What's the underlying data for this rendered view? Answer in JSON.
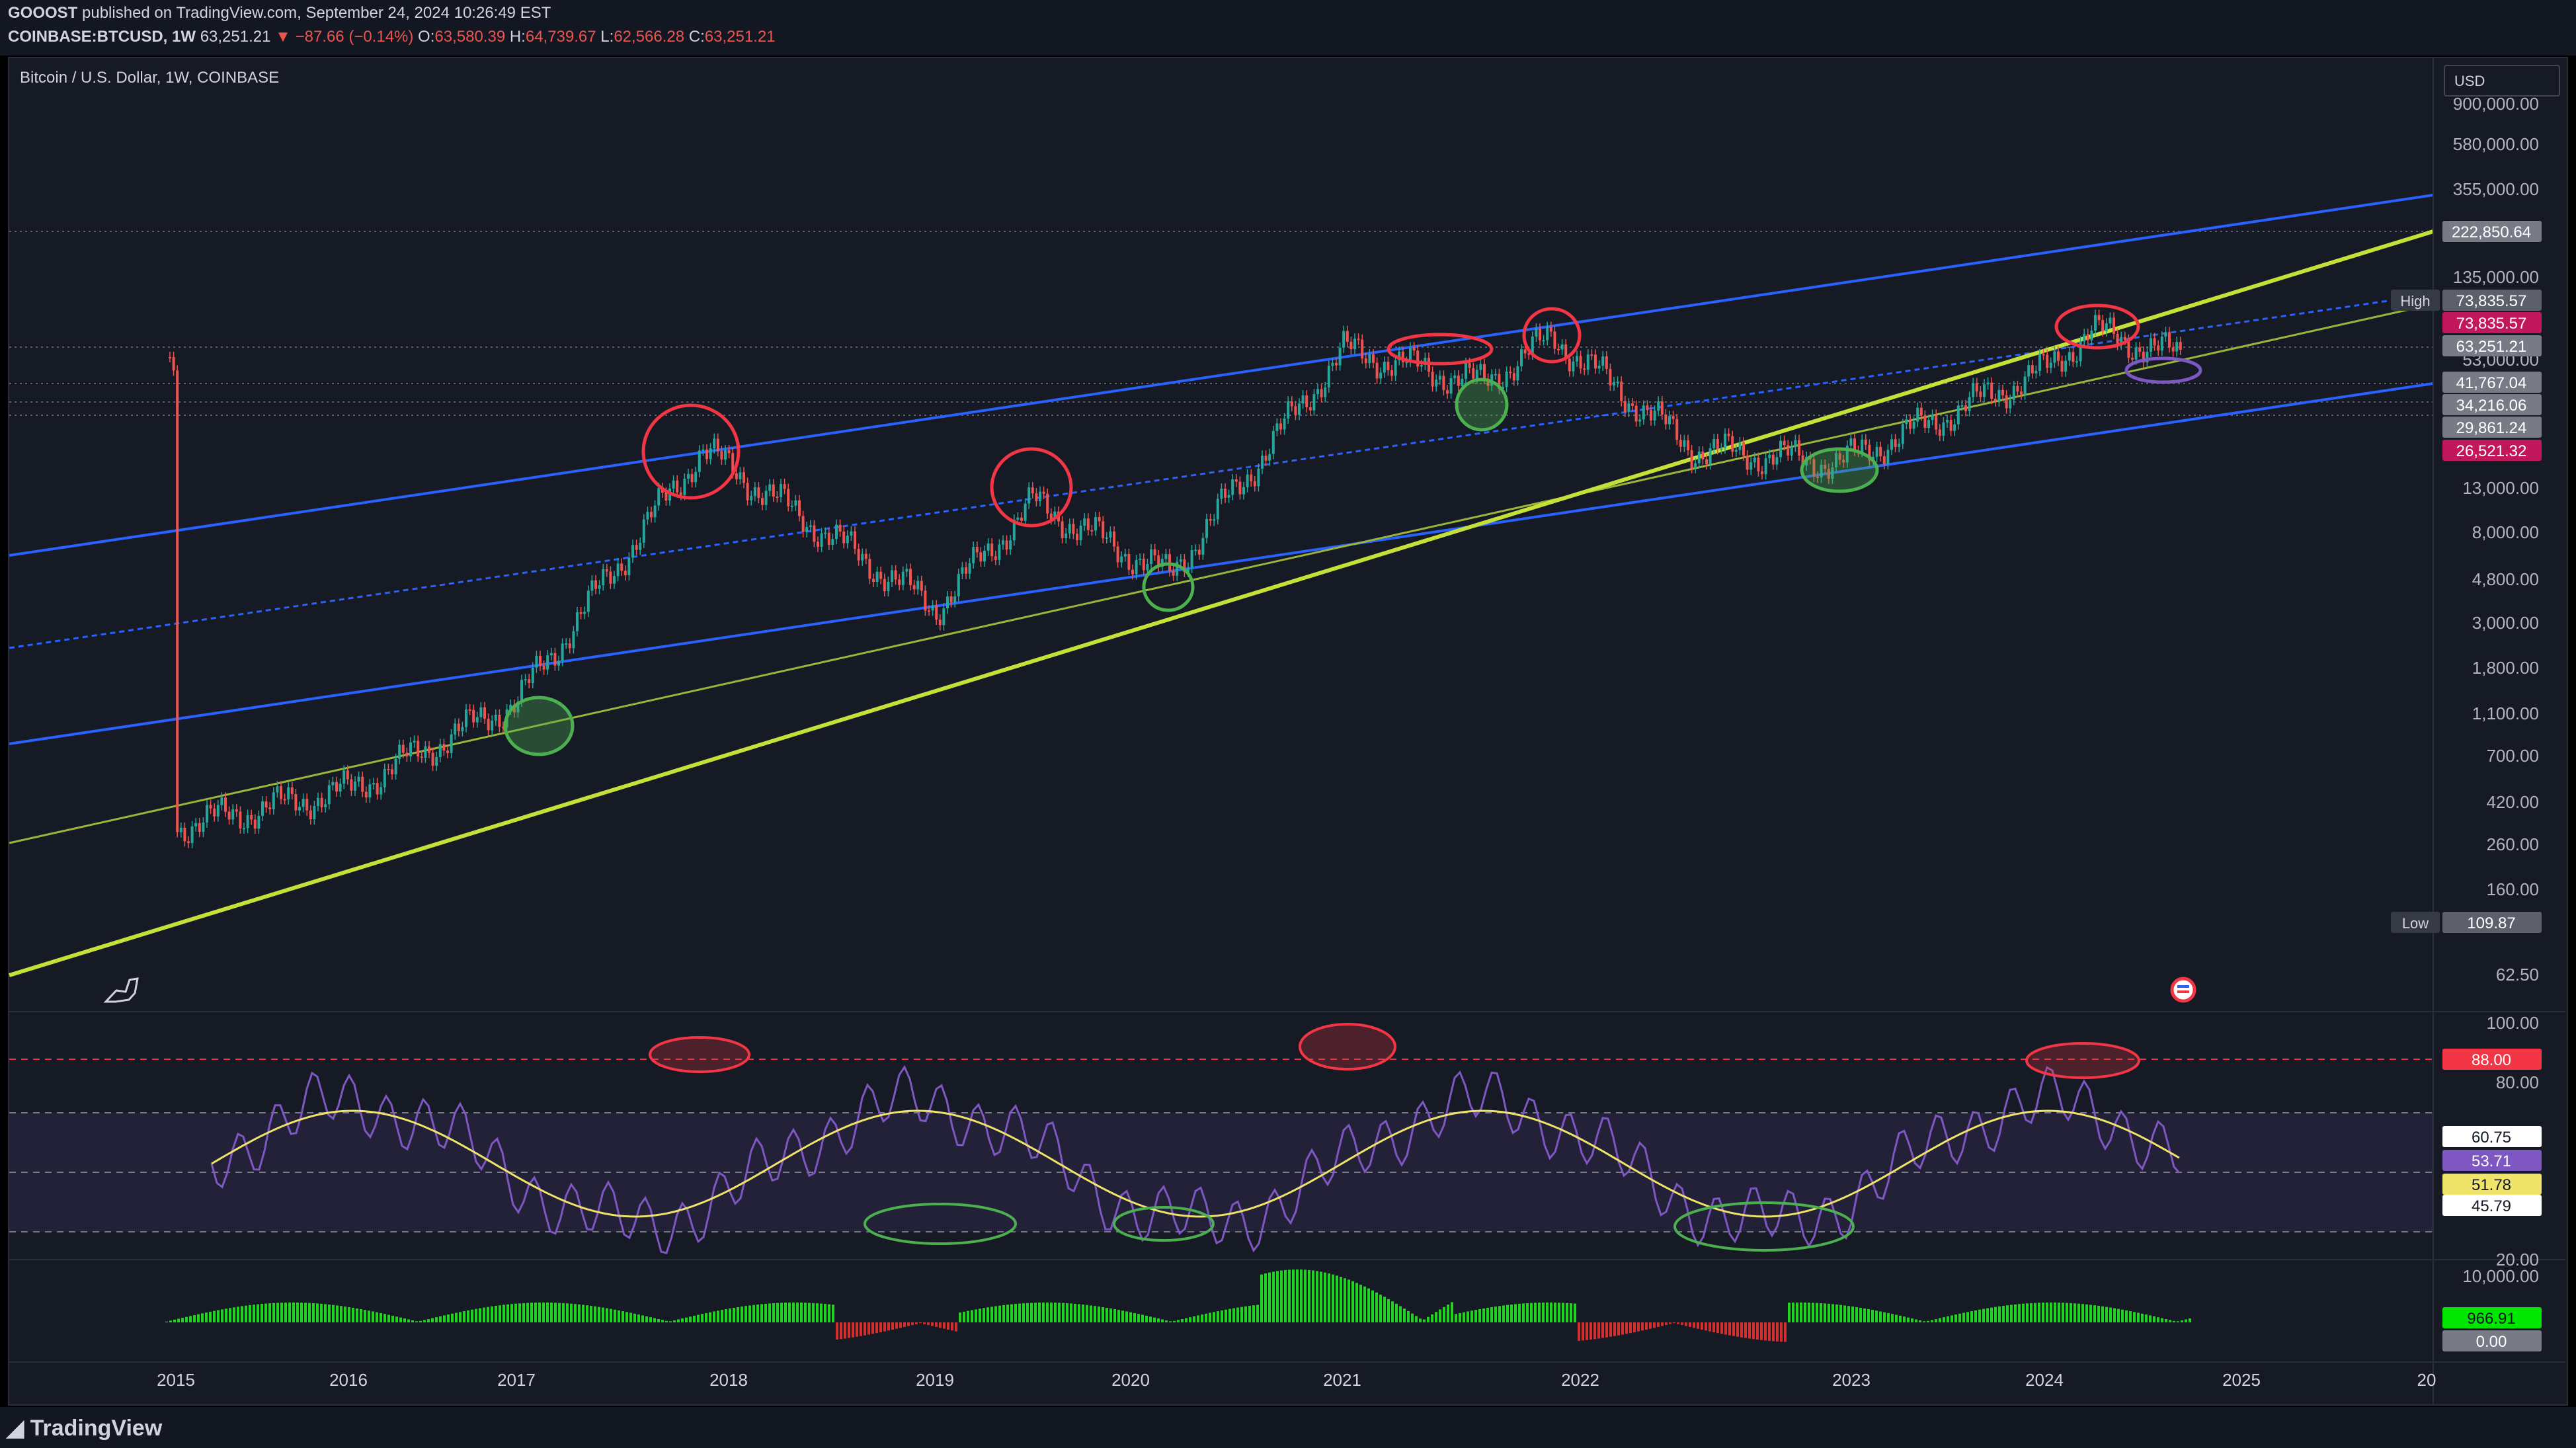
{
  "header": {
    "publisher": "GOOOST",
    "published_text": "published on TradingView.com, September 24, 2024 10:26:49 EST",
    "symbol": "COINBASE:BTCUSD, 1W",
    "last": "63,251.21",
    "change": "−87.66 (−0.14%)",
    "open_label": "O:",
    "open": "63,580.39",
    "high_label": "H:",
    "high": "64,739.67",
    "low_label": "L:",
    "low": "62,566.28",
    "close_label": "C:",
    "close": "63,251.21"
  },
  "chart_title": "Bitcoin / U.S. Dollar, 1W, COINBASE",
  "currency": "USD",
  "footer_logo": "TradingView",
  "colors": {
    "background": "#161a25",
    "channel_blue": "#2962ff",
    "trend_yellow": "#c6e03a",
    "trend_olive": "#9bb53a",
    "rsi_purple": "#7e57c2",
    "rsi_ma_yellow": "#f0e36a",
    "up_candle": "#26a69a",
    "down_candle": "#ef5350",
    "red_circle": "#f23645",
    "green_circle": "#4caf50"
  },
  "price_axis": {
    "ticks": [
      "900,000.00",
      "580,000.00",
      "355,000.00",
      "135,000.00",
      "53,000.00",
      "13,000.00",
      "8,000.00",
      "4,800.00",
      "3,000.00",
      "1,800.00",
      "1,100.00",
      "700.00",
      "420.00",
      "260.00",
      "160.00",
      "62.50"
    ],
    "badges": [
      {
        "label": "",
        "value": "222,850.64",
        "color": "#787b86"
      },
      {
        "label": "High",
        "value": "73,835.57",
        "color": "#5d606b"
      },
      {
        "label": "",
        "value": "73,835.57",
        "color": "#c2185b"
      },
      {
        "label": "",
        "value": "63,251.21",
        "color": "#787b86"
      },
      {
        "label": "",
        "value": "41,767.04",
        "color": "#787b86"
      },
      {
        "label": "",
        "value": "34,216.06",
        "color": "#787b86"
      },
      {
        "label": "",
        "value": "29,861.24",
        "color": "#787b86"
      },
      {
        "label": "",
        "value": "26,521.32",
        "color": "#c2185b"
      },
      {
        "label": "Low",
        "value": "109.87",
        "color": "#5d606b"
      }
    ]
  },
  "rsi_axis": {
    "ticks": [
      "100.00",
      "80.00",
      "20.00"
    ],
    "badges": [
      {
        "value": "88.00",
        "color": "#f23645"
      },
      {
        "value": "60.75",
        "color": "#ffffff"
      },
      {
        "value": "53.71",
        "color": "#7e57c2"
      },
      {
        "value": "51.78",
        "color": "#f0e36a"
      },
      {
        "value": "45.79",
        "color": "#ffffff"
      }
    ]
  },
  "volume_axis": {
    "ticks": [
      "10,000.00"
    ],
    "badges": [
      {
        "value": "966.91",
        "color": "#00e600"
      },
      {
        "value": "0.00",
        "color": "#787b86"
      }
    ]
  },
  "time_axis": [
    "2015",
    "2016",
    "2017",
    "2018",
    "2019",
    "2020",
    "2021",
    "2022",
    "2023",
    "2024",
    "2025",
    "20"
  ],
  "chart_data": {
    "type": "line",
    "series": [
      {
        "x": [
          "2015",
          "2016",
          "2017",
          "2018",
          "2019",
          "2020",
          "2021",
          "2022",
          "2023",
          "2024"
        ],
        "values": [
          300,
          400,
          800,
          13000,
          3800,
          7200,
          30000,
          46000,
          16500,
          42000
        ]
      }
    ]
  }
}
